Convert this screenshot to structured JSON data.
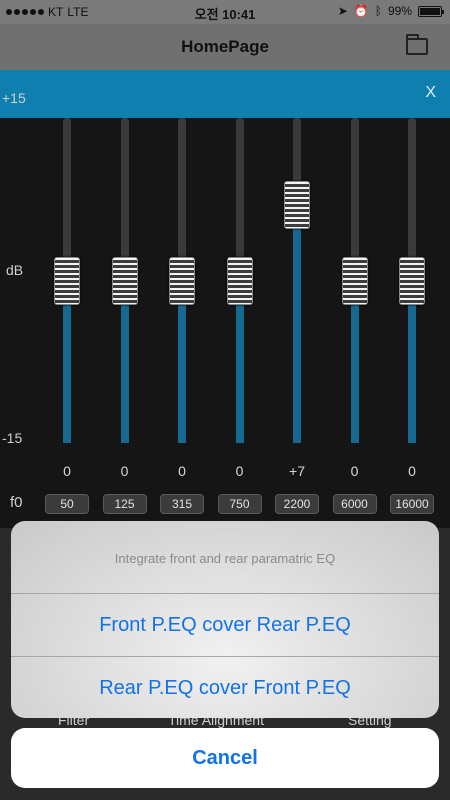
{
  "status_bar": {
    "carrier": "KT",
    "network": "LTE",
    "time": "오전 10:41",
    "battery": "99%",
    "battery_fraction": 0.99
  },
  "nav": {
    "title": "HomePage",
    "folder_icon": "folder-icon"
  },
  "banner": {
    "close_label": "X"
  },
  "eq": {
    "axis_top": "+15",
    "axis_mid": "dB",
    "axis_bottom": "-15",
    "f0_label": "f0",
    "range": [
      -15,
      15
    ],
    "bands": [
      {
        "gain": 0,
        "gain_label": "0",
        "freq": "50"
      },
      {
        "gain": 0,
        "gain_label": "0",
        "freq": "125"
      },
      {
        "gain": 0,
        "gain_label": "0",
        "freq": "315"
      },
      {
        "gain": 0,
        "gain_label": "0",
        "freq": "750"
      },
      {
        "gain": 7,
        "gain_label": "+7",
        "freq": "2200"
      },
      {
        "gain": 0,
        "gain_label": "0",
        "freq": "6000"
      },
      {
        "gain": 0,
        "gain_label": "0",
        "freq": "16000"
      }
    ]
  },
  "bottom_tabs": {
    "filter": "Filter",
    "time_alignment": "Time Alignment",
    "setting": "Setting"
  },
  "action_sheet": {
    "message": "Integrate front and rear paramatric EQ",
    "option_1": "Front P.EQ cover Rear P.EQ",
    "option_2": "Rear P.EQ cover Front P.EQ",
    "cancel": "Cancel"
  },
  "colors": {
    "accent_blue": "#1272ea",
    "banner_blue": "#0f7fb0",
    "eq_fill": "#166a92"
  }
}
